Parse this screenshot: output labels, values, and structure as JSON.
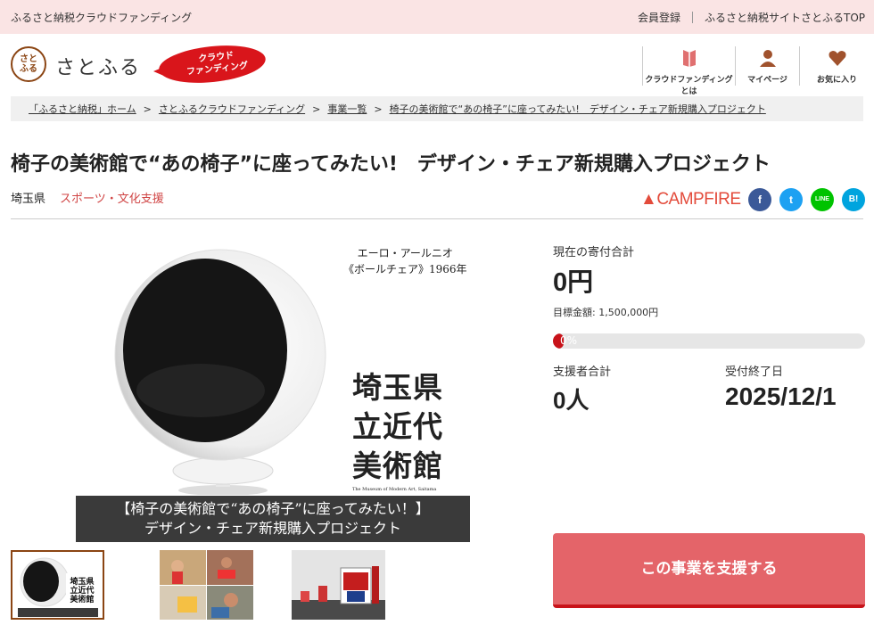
{
  "topbar": {
    "site_name": "ふるさと納税クラウドファンディング",
    "links": [
      "会員登録",
      "ふるさと納税サイトさとふるTOP"
    ]
  },
  "header": {
    "logo_seal": "さとふる",
    "logo_text": "さとふる",
    "badge_line1": "クラウド",
    "badge_line2": "ファンディング",
    "nav": [
      {
        "label": "クラウドファンディングとは",
        "icon": "book-icon"
      },
      {
        "label": "マイページ",
        "icon": "user-icon"
      },
      {
        "label": "お気に入り",
        "icon": "heart-icon"
      }
    ]
  },
  "breadcrumb": [
    "「ふるさと納税」ホーム",
    "さとふるクラウドファンディング",
    "事業一覧",
    "椅子の美術館で“あの椅子”に座ってみたい!　デザイン・チェア新規購入プロジェクト"
  ],
  "project": {
    "title": "椅子の美術館で“あの椅子”に座ってみたい!　デザイン・チェア新規購入プロジェクト",
    "prefecture": "埼玉県",
    "category": "スポーツ・文化支援",
    "platform": "CAMPFIRE"
  },
  "social": [
    {
      "name": "facebook",
      "glyph": "f",
      "color": "#3b5998"
    },
    {
      "name": "twitter",
      "glyph": "t",
      "color": "#1da1f2"
    },
    {
      "name": "line",
      "glyph": "LINE",
      "color": "#00c300"
    },
    {
      "name": "hatena",
      "glyph": "B!",
      "color": "#00a4de"
    }
  ],
  "hero": {
    "artist_line1": "エーロ・アールニオ",
    "artist_line2": "《ボールチェア》1966年",
    "museum_line1": "埼玉県",
    "museum_line2": "立近代",
    "museum_line3": "美術館",
    "museum_en": "The Museum of Modern Art, Saitama",
    "banner_line1": "【椅子の美術館で“あの椅子”に座ってみたい！】",
    "banner_line2": "デザイン・チェア新規購入プロジェクト"
  },
  "stats": {
    "current_label": "現在の寄付合計",
    "current_value": "0円",
    "goal_text": "目標金額: 1,500,000円",
    "progress_text": "0%",
    "progress_fraction": 0,
    "supporters_label": "支援者合計",
    "supporters_value": "0人",
    "deadline_label": "受付終了日",
    "deadline_value": "2025/12/1"
  },
  "cta": {
    "label": "この事業を支援する"
  },
  "colors": {
    "accent": "#c8131a",
    "button": "#e46469",
    "topbar": "#fae4e4",
    "category": "#d04545"
  }
}
